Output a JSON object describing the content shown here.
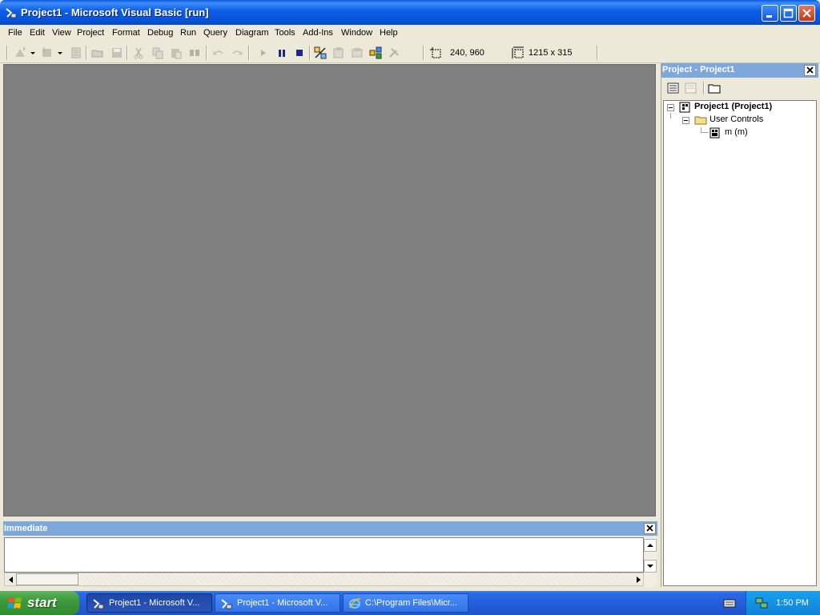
{
  "window": {
    "title": "Project1 - Microsoft Visual Basic [run]"
  },
  "menu": [
    "File",
    "Edit",
    "View",
    "Project",
    "Format",
    "Debug",
    "Run",
    "Query",
    "Diagram",
    "Tools",
    "Add-Ins",
    "Window",
    "Help"
  ],
  "toolbar": {
    "position": "240, 960",
    "size": "1215 x 315"
  },
  "immediate": {
    "title": "Immediate",
    "content": ""
  },
  "project": {
    "title": "Project - Project1",
    "tree": {
      "root": "Project1 (Project1)",
      "folder": "User Controls",
      "item": "m (m)"
    }
  },
  "taskbar": {
    "start": "start",
    "buttons": [
      "Project1 - Microsoft V...",
      "Project1 - Microsoft V...",
      "C:\\Program Files\\Micr..."
    ],
    "clock": "1:50 PM"
  },
  "colors": {
    "titlebar": "#0554dc",
    "mdi": "#808080",
    "panel_header": "#7ea8dc"
  }
}
